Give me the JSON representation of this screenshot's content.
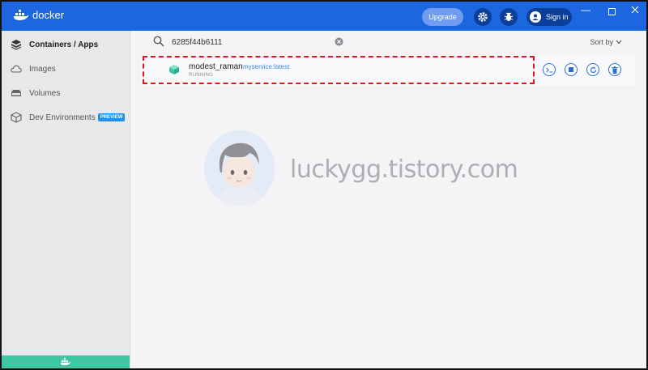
{
  "app": {
    "logo_text": "docker"
  },
  "titlebar": {
    "upgrade_label": "Upgrade",
    "signin_label": "Sign in",
    "icons": [
      "settings-gear-icon",
      "bug-icon",
      "user-icon"
    ],
    "window_controls": [
      "minimize",
      "maximize",
      "close"
    ]
  },
  "sidebar": {
    "items": [
      {
        "label": "Containers / Apps",
        "icon": "containers-icon",
        "active": true
      },
      {
        "label": "Images",
        "icon": "cloud-icon",
        "active": false
      },
      {
        "label": "Volumes",
        "icon": "disk-icon",
        "active": false
      },
      {
        "label": "Dev Environments",
        "icon": "dev-env-icon",
        "active": false,
        "badge": "PREVIEW"
      }
    ]
  },
  "search": {
    "value": "6285f44b6111"
  },
  "sort": {
    "label": "Sort by"
  },
  "containers": [
    {
      "name": "modest_raman",
      "image": "myservice:latest",
      "status": "RUNNING"
    }
  ],
  "watermark": {
    "text": "luckygg.tistory.com"
  },
  "colors": {
    "brand": "#1c66e0",
    "status_green": "#3ec7a5",
    "highlight": "#e0141c",
    "link": "#3b87e6"
  }
}
